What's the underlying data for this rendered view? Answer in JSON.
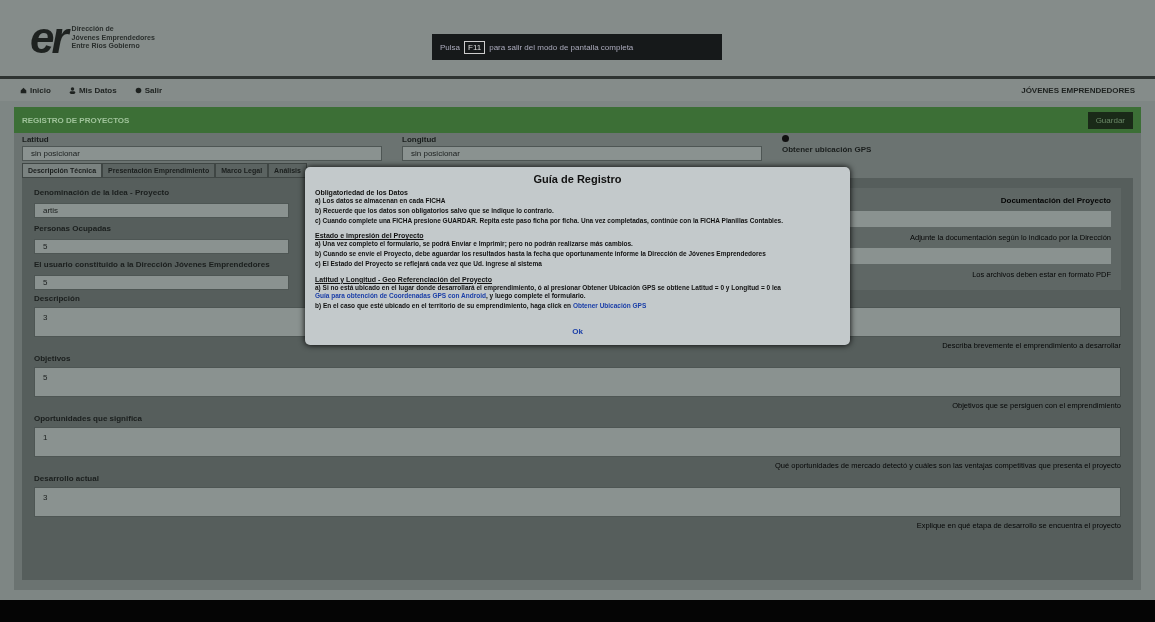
{
  "header": {
    "logo_mark": "er",
    "logo_lines": [
      "Dirección de",
      "Jóvenes Emprendedores",
      "Entre Ríos Gobierno"
    ],
    "fullscreen_notice": {
      "prefix": "Pulsa",
      "key": "F11",
      "suffix": "para salir del modo de pantalla completa"
    }
  },
  "nav": {
    "items": [
      {
        "label": "Inicio"
      },
      {
        "label": "Mis Datos"
      },
      {
        "label": "Salir"
      }
    ],
    "user": "JÓVENES EMPRENDEDORES"
  },
  "title_bar": {
    "title": "REGISTRO DE PROYECTOS",
    "button": "Guardar"
  },
  "location": {
    "latitude_label": "Latitud",
    "latitude_value": "sin posicionar",
    "longitude_label": "Longitud",
    "longitude_value": "sin posicionar",
    "gps_button": "Obtener ubicación GPS"
  },
  "tabs": [
    {
      "label": "Descripción Técnica",
      "selected": true
    },
    {
      "label": "Presentación Emprendimiento",
      "selected": false
    },
    {
      "label": "Marco Legal",
      "selected": false
    },
    {
      "label": "Análisis",
      "selected": false
    }
  ],
  "short_fields": [
    {
      "label": "Denominación de la Idea - Proyecto",
      "value": "artis"
    },
    {
      "label": "Personas Ocupadas",
      "value": "5"
    },
    {
      "label": "El usuario constituido a la Dirección Jóvenes Emprendedores",
      "value": "5"
    }
  ],
  "documents": {
    "title": "Documentación del Proyecto",
    "hints": [
      "Adjunte la documentación según lo indicado por la Dirección",
      "Los archivos deben estar en formato PDF"
    ]
  },
  "long_fields": [
    {
      "label": "Descripción",
      "value": "3",
      "hint": "Describa brevemente el emprendimiento a desarrollar"
    },
    {
      "label": "Objetivos",
      "value": "5",
      "hint": "Objetivos que se persiguen con el emprendimiento"
    },
    {
      "label": "Oportunidades que significa",
      "value": "1",
      "hint": "Qué oportunidades de mercado detectó y cuáles son las ventajas competitivas que presenta el proyecto"
    },
    {
      "label": "Desarrollo actual",
      "value": "3",
      "hint": "Explique en qué etapa de desarrollo se encuentra el proyecto"
    }
  ],
  "modal": {
    "title": "Guía de Registro",
    "sections": [
      {
        "heading": "Obligatoriedad de los Datos",
        "underlined": false,
        "lines": [
          "a) Los datos se almacenan en cada FICHA",
          "b) Recuerde que los datos son **obligatorios** salvo que se indique lo contrario.",
          "c) Cuando complete una FICHA presione GUARDAR. Repita este paso ficha por ficha. Una vez completadas, continúe con la FICHA Planillas Contables."
        ]
      },
      {
        "heading": "Estado e impresión del Proyecto",
        "underlined": true,
        "lines": [
          "a) Una vez completo el formulario, se podrá Enviar e Imprimir; **pero no podrán realizarse más cambios.**",
          "b) Cuando se envíe el Proyecto, debe aguardar los resultados hasta la fecha que oportunamente informe la Dirección de Jóvenes Emprendedores",
          "c) El Estado del Proyecto se reflejará cada vez que Ud. ingrese al sistema"
        ]
      },
      {
        "heading": "Latitud y Longitud - Geo Referenciación del Proyecto",
        "underlined": true,
        "lines": [
          {
            "parts": [
              {
                "text": "a) Si no está ubicado en el lugar donde desarrollará el emprendimiento, ó al presionar Obtener Ubicación GPS se obtiene Latitud = 0 y Longitud = 0 lea ",
                "kind": "text"
              },
              {
                "text": "Guía para obtención de Coordenadas GPS con Android",
                "kind": "link"
              },
              {
                "text": ", y luego complete el formulario.",
                "kind": "text"
              }
            ]
          },
          {
            "parts": [
              {
                "text": "b) En el caso que esté ubicado en el territorio de su emprendimiento, haga click en ",
                "kind": "text"
              },
              {
                "text": "Obtener Ubicación GPS",
                "kind": "link"
              }
            ]
          }
        ]
      }
    ],
    "ok": "Ok"
  }
}
